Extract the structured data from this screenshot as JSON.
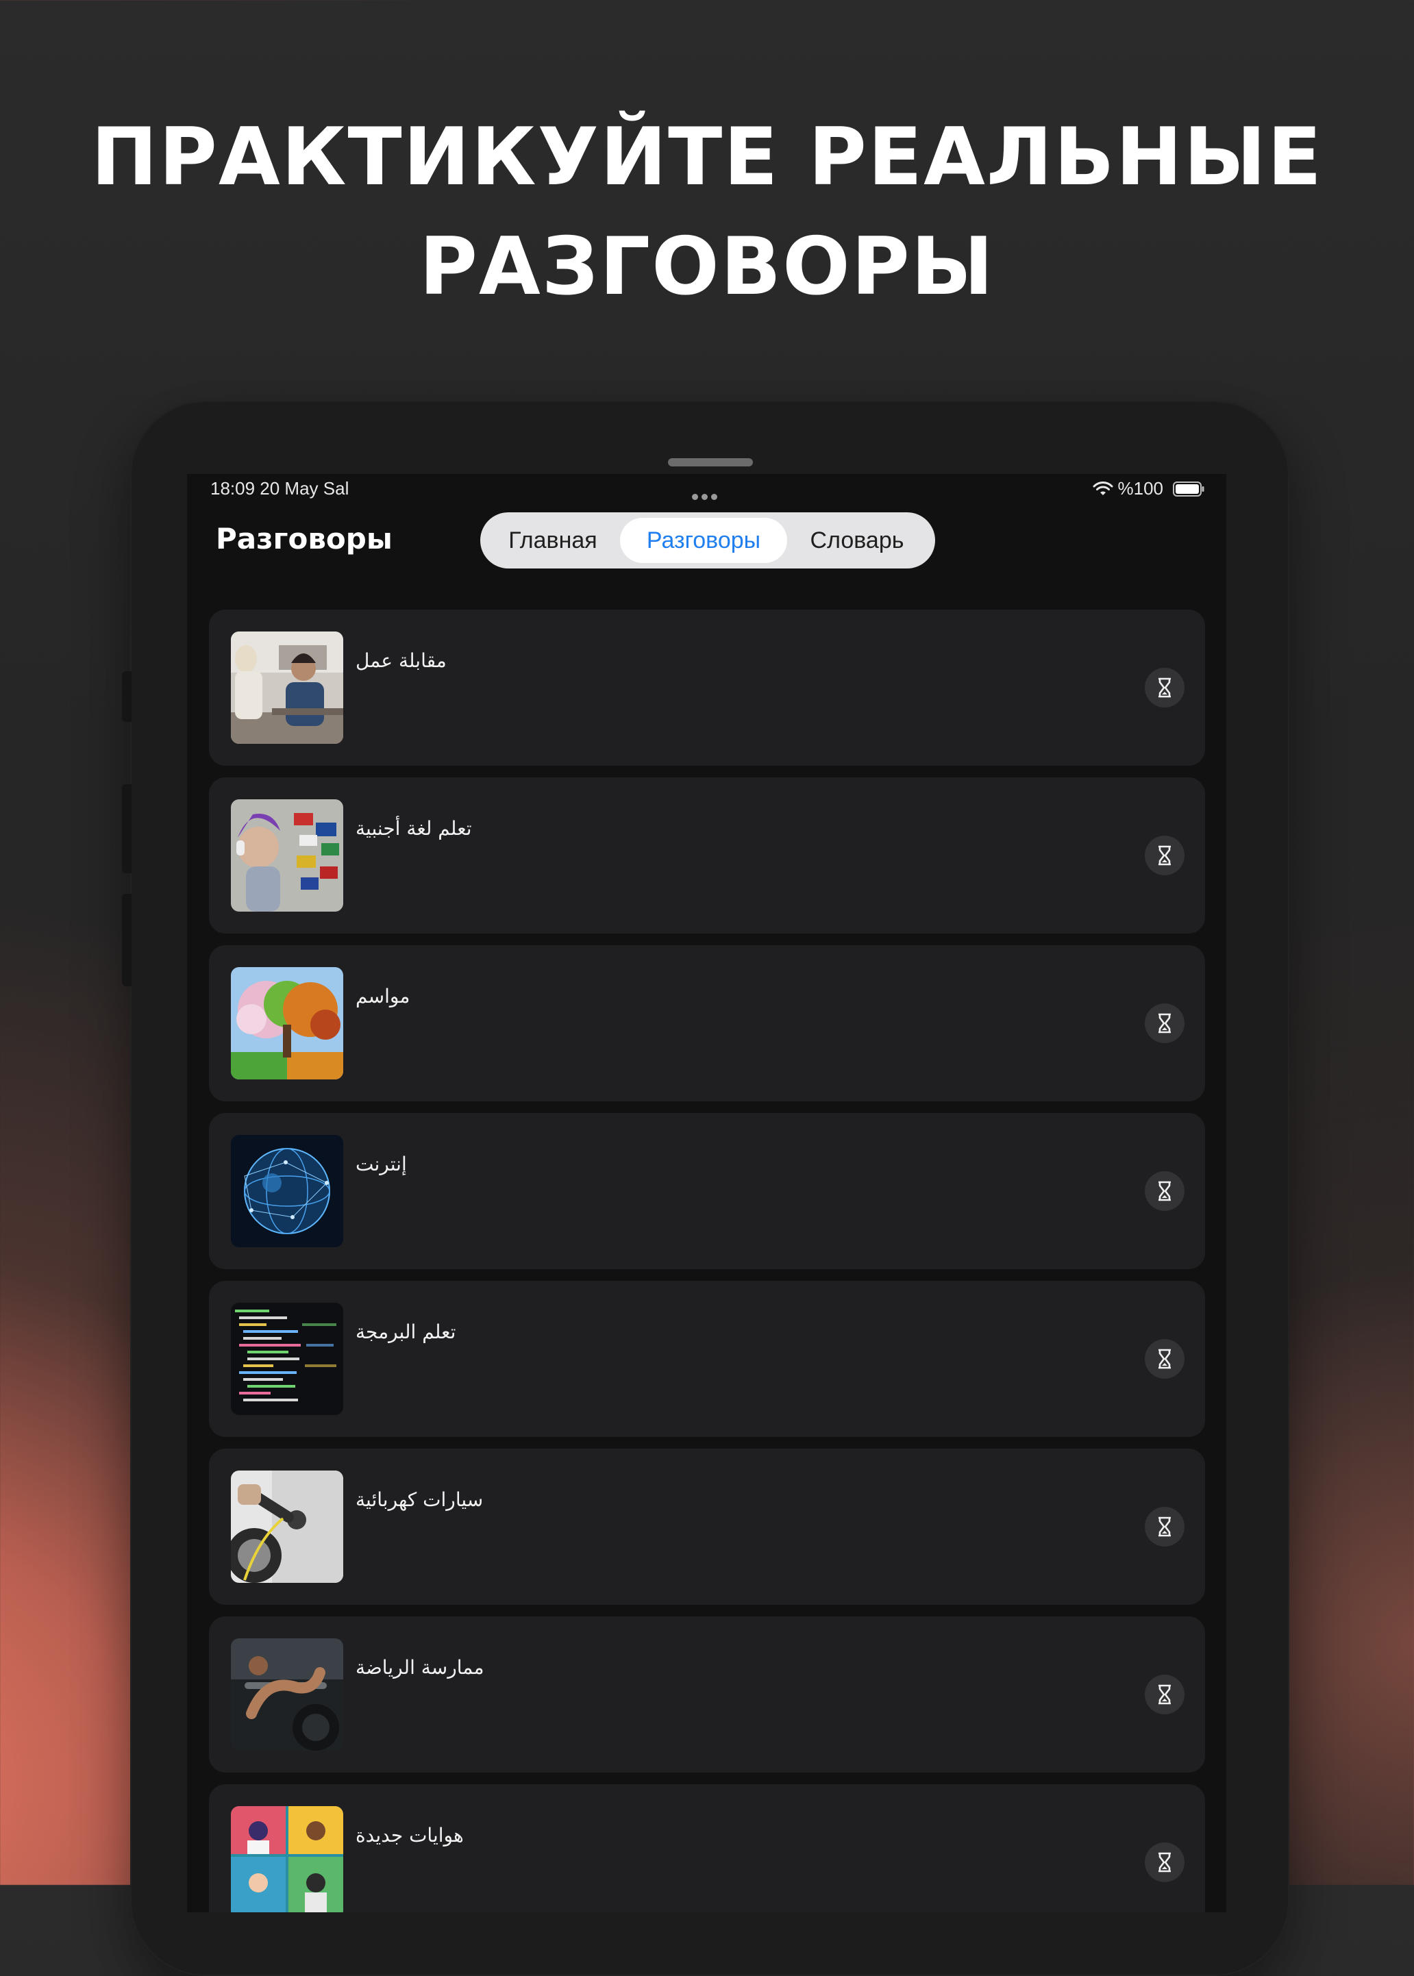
{
  "headline": {
    "line1": "ПРАКТИКУЙТЕ РЕАЛЬНЫЕ",
    "line2": "РАЗГОВОРЫ"
  },
  "status_bar": {
    "time": "18:09   20 May Sal",
    "battery": "%100",
    "icons": [
      "wifi-icon",
      "battery-icon",
      "more-dots-icon"
    ]
  },
  "header": {
    "title": "Разговоры"
  },
  "tabs": {
    "home": "Главная",
    "conversations": "Разговоры",
    "dictionary": "Словарь",
    "selected": "conversations",
    "accent_color": "#1f7ff0"
  },
  "conversations": [
    {
      "title": "مقابلة عمل",
      "image": "job-interview-image",
      "status_icon": "hourglass-icon"
    },
    {
      "title": "تعلم لغة أجنبية",
      "image": "foreign-language-image",
      "status_icon": "hourglass-icon"
    },
    {
      "title": "مواسم",
      "image": "seasons-tree-image",
      "status_icon": "hourglass-icon"
    },
    {
      "title": "إنترنت",
      "image": "internet-globe-image",
      "status_icon": "hourglass-icon"
    },
    {
      "title": "تعلم البرمجة",
      "image": "programming-code-image",
      "status_icon": "hourglass-icon"
    },
    {
      "title": "سيارات كهربائية",
      "image": "electric-car-image",
      "status_icon": "hourglass-icon"
    },
    {
      "title": "ممارسة الرياضة",
      "image": "sports-workout-image",
      "status_icon": "hourglass-icon"
    },
    {
      "title": "هوايات جديدة",
      "image": "new-hobbies-image",
      "status_icon": "hourglass-icon"
    }
  ]
}
